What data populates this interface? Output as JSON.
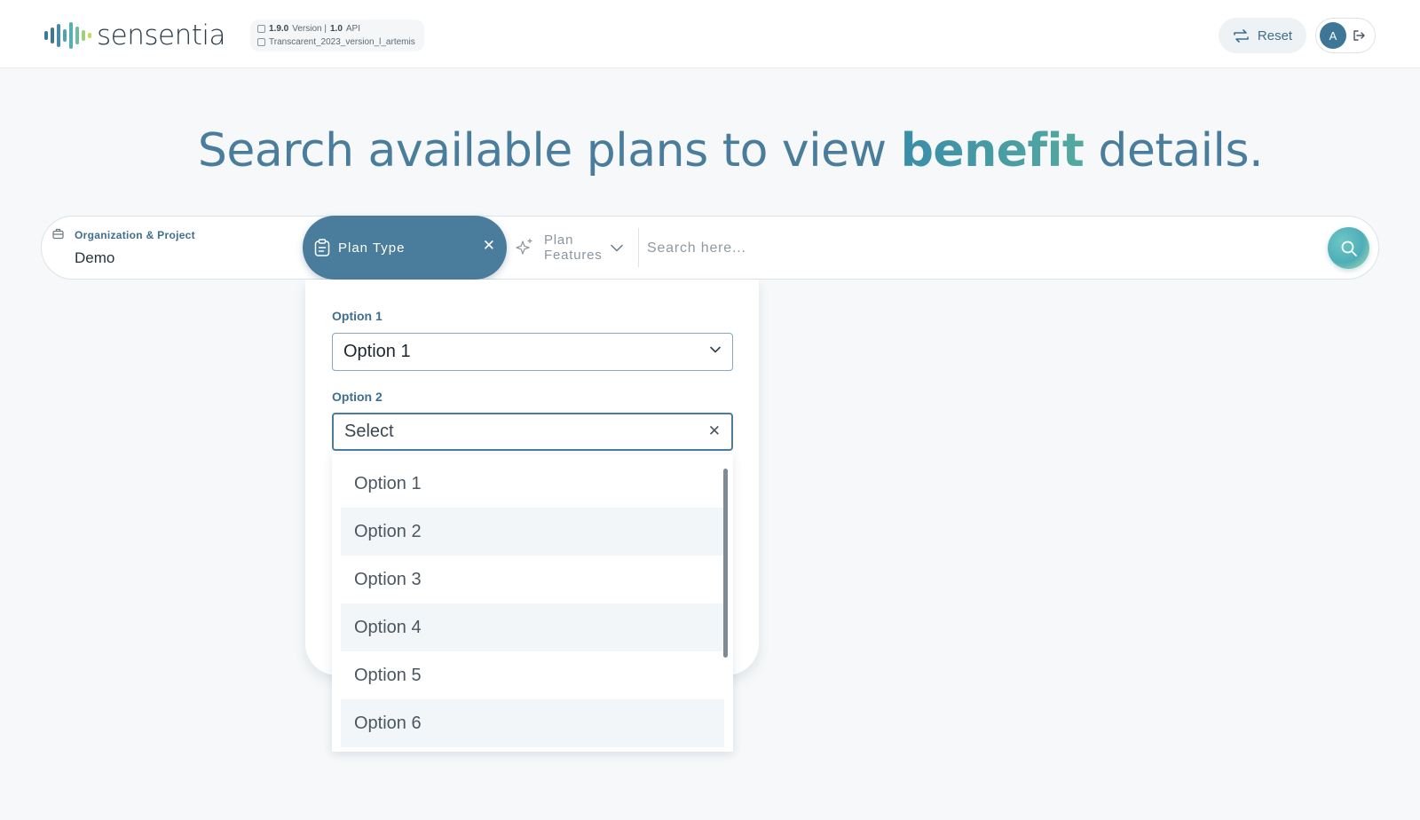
{
  "brand": {
    "name": "sensentia"
  },
  "header": {
    "version": "1.9.0",
    "version_label": "Version |",
    "api": "1.0",
    "api_label": "API",
    "dataset": "Transcarent_2023_version_l_artemis",
    "reset_label": "Reset",
    "avatar_initial": "A"
  },
  "headline": {
    "before": "Search available plans to view ",
    "highlight": "benefit",
    "after": " details."
  },
  "search": {
    "org_label": "Organization & Project",
    "org_value": "Demo",
    "plan_type_label": "Plan Type",
    "features_label": "Plan Features",
    "placeholder": "Search here..."
  },
  "panel": {
    "option1_label": "Option 1",
    "option1_value": "Option 1",
    "option2_label": "Option 2",
    "option2_placeholder": "Select",
    "options": [
      "Option 1",
      "Option 2",
      "Option 3",
      "Option 4",
      "Option 5",
      "Option 6"
    ]
  },
  "colors": {
    "primary": "#4a7d9c",
    "accent": "#3d91a0",
    "background": "#f6f8f9"
  }
}
